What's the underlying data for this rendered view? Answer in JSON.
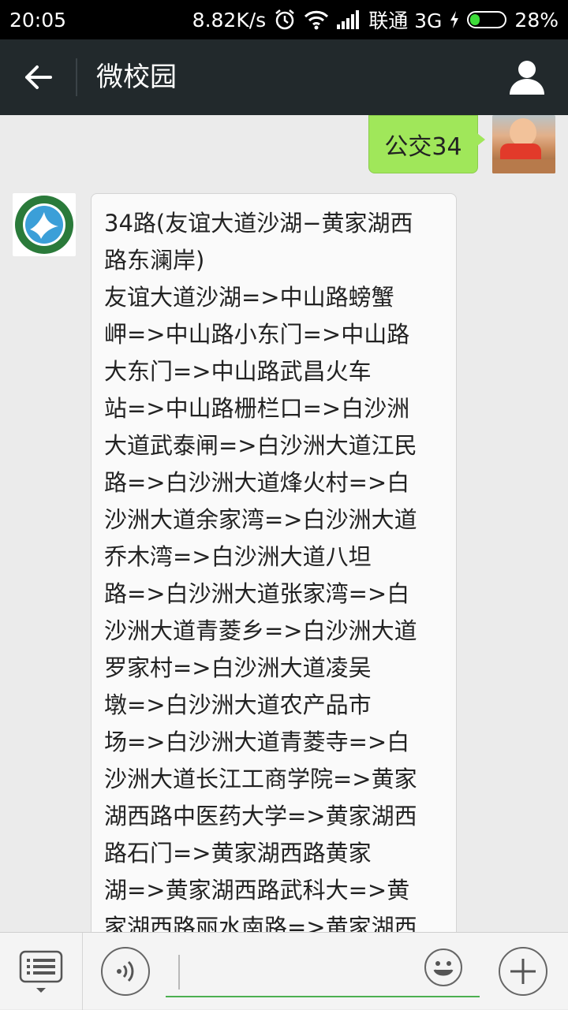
{
  "status_bar": {
    "time": "20:05",
    "speed": "8.82K/s",
    "carrier": "联通 3G",
    "battery_percent": "28%",
    "battery_level": 0.28
  },
  "title_bar": {
    "title": "微校园"
  },
  "messages": {
    "outgoing": {
      "text": "公交34"
    },
    "incoming": {
      "lines": [
        "34路(友谊大道沙湖−黄家湖西",
        "路东澜岸)",
        "友谊大道沙湖=>中山路螃蟹",
        "岬=>中山路小东门=>中山路",
        "大东门=>中山路武昌火车",
        "站=>中山路栅栏口=>白沙洲",
        "大道武泰闸=>白沙洲大道江民",
        "路=>白沙洲大道烽火村=>白",
        "沙洲大道余家湾=>白沙洲大道",
        "乔木湾=>白沙洲大道八坦",
        "路=>白沙洲大道张家湾=>白",
        "沙洲大道青菱乡=>白沙洲大道",
        "罗家村=>白沙洲大道凌吴",
        "墩=>白沙洲大道农产品市",
        "场=>白沙洲大道青菱寺=>白",
        "沙洲大道长江工商学院=>黄家",
        "湖西路中医药大学=>黄家湖西",
        "路石门=>黄家湖西路黄家",
        "湖=>黄家湖西路武科大=>黄",
        "家湖西路丽水南路=>黄家湖西"
      ]
    }
  },
  "colors": {
    "title_bar_bg": "#22292c",
    "chat_bg": "#ebebeb",
    "outgoing_bubble": "#a0e75a",
    "incoming_bubble": "#fafafa",
    "accent": "#4caf50"
  }
}
